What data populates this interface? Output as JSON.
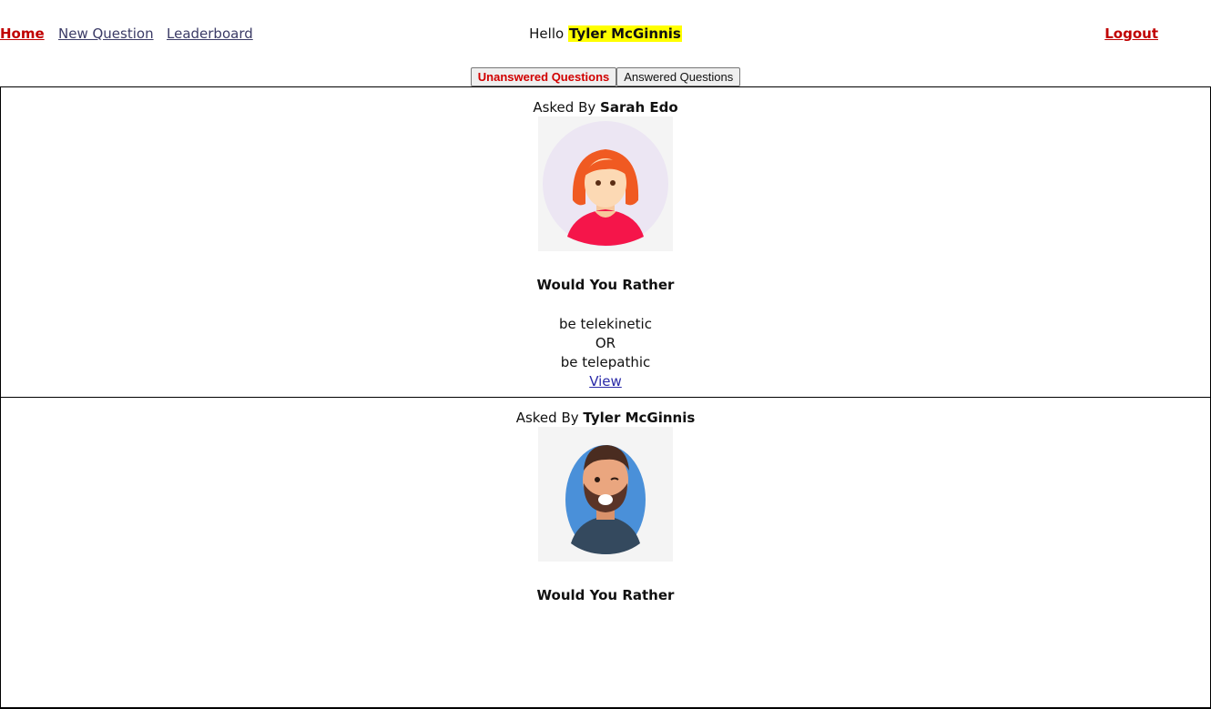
{
  "nav": {
    "home": "Home",
    "new_question": "New Question",
    "leaderboard": "Leaderboard",
    "logout": "Logout",
    "greeting": "Hello",
    "user_name": "Tyler McGinnis"
  },
  "tabs": {
    "unanswered": "Unanswered Questions",
    "answered": "Answered Questions"
  },
  "questions": [
    {
      "asked_by_label": "Asked By",
      "author": "Sarah Edo",
      "avatar_icon": "woman-avatar-icon",
      "heading": "Would You Rather",
      "option_one": "be telekinetic",
      "or_text": "OR",
      "option_two": "be telepathic",
      "view_link": "View"
    },
    {
      "asked_by_label": "Asked By",
      "author": "Tyler McGinnis",
      "avatar_icon": "bearded-man-avatar-icon",
      "heading": "Would You Rather",
      "option_one": "",
      "or_text": "",
      "option_two": "",
      "view_link": ""
    }
  ],
  "colors": {
    "accent_red": "#c00000",
    "highlight_yellow": "#ffff00",
    "link_blue": "#2a2aa8"
  }
}
